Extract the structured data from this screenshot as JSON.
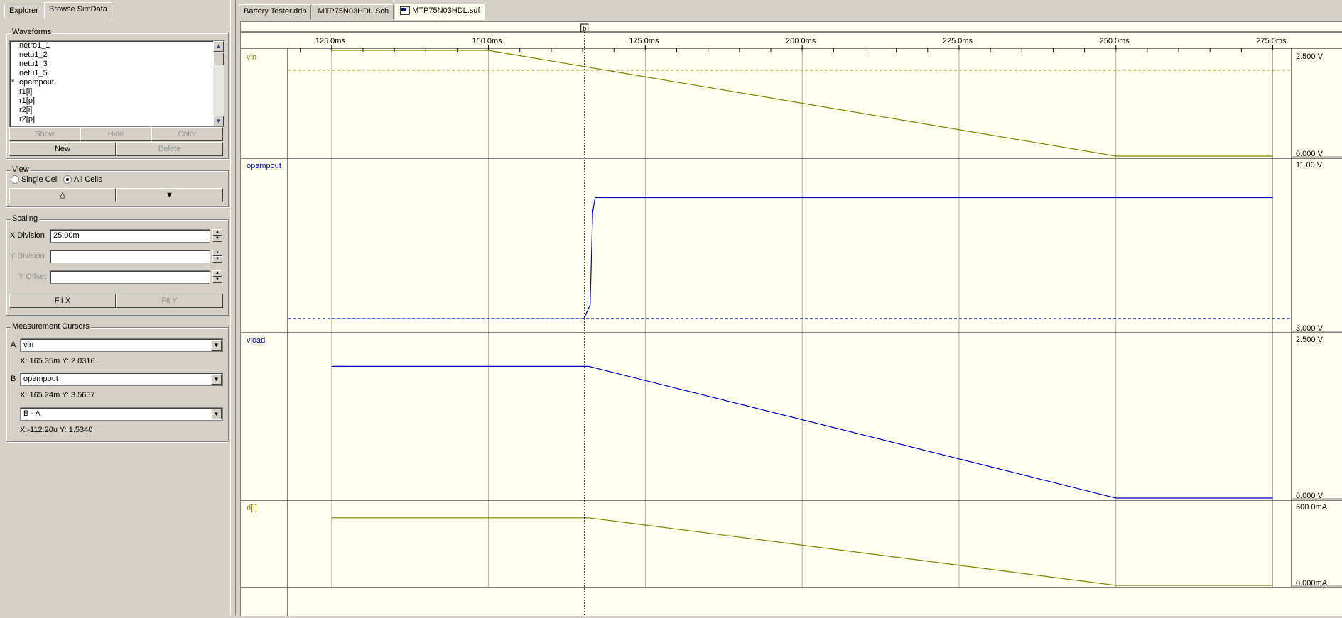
{
  "left_panel": {
    "tabs": [
      {
        "label": "Explorer"
      },
      {
        "label": "Browse SimData"
      }
    ],
    "waveforms": {
      "legend": "Waveforms",
      "items": [
        {
          "label": "netro1_1",
          "star": ""
        },
        {
          "label": "netu1_2",
          "star": ""
        },
        {
          "label": "netu1_3",
          "star": ""
        },
        {
          "label": "netu1_5",
          "star": ""
        },
        {
          "label": "opampout",
          "star": "*"
        },
        {
          "label": "r1[i]",
          "star": ""
        },
        {
          "label": "r1[p]",
          "star": ""
        },
        {
          "label": "r2[i]",
          "star": ""
        },
        {
          "label": "r2[p]",
          "star": ""
        }
      ],
      "show_label": "Show",
      "hide_label": "Hide",
      "color_label": "Color",
      "new_label": "New",
      "delete_label": "Delete"
    },
    "view": {
      "legend": "View",
      "single_cell_label": "Single Cell",
      "all_cells_label": "All Cells",
      "selected": "All Cells",
      "up_label": "△",
      "down_label": "▼"
    },
    "scaling": {
      "legend": "Scaling",
      "x_division_label": "X Division",
      "x_division_value": "25.00m",
      "y_division_label": "Y Division",
      "y_division_value": "",
      "y_offset_label": "Y Offset",
      "y_offset_value": "",
      "fit_x_label": "Fit X",
      "fit_y_label": "Fit Y"
    },
    "cursors": {
      "legend": "Measurement Cursors",
      "a_label": "A",
      "a_value": "vin",
      "a_readout": "X: 165.35m  Y: 2.0316",
      "b_label": "B",
      "b_value": "opampout",
      "b_readout": "X: 165.24m  Y: 3.5657",
      "diff_value": "B - A",
      "diff_readout": "X:-112.20u  Y: 1.5340"
    }
  },
  "doc_tabs": [
    {
      "label": "Battery Tester.ddb",
      "active": false
    },
    {
      "label": "MTP75N03HDL.Sch",
      "active": false
    },
    {
      "label": "MTP75N03HDL.sdf",
      "active": true
    }
  ],
  "chart_data": {
    "type": "line",
    "x_unit": "ms",
    "xlim": [
      118,
      278
    ],
    "x_ticks": [
      125,
      150,
      175,
      200,
      225,
      250,
      275
    ],
    "x_tick_labels": [
      "125.0ms",
      "150.0ms",
      "175.0ms",
      "200.0ms",
      "225.0ms",
      "250.0ms",
      "275.0ms"
    ],
    "cursor_marker": "b",
    "cursor_x": 165.3,
    "colors": {
      "olive": "#808000",
      "blue": "#0000c0",
      "grid": "#b0b0a0",
      "bg": "#fffff0"
    },
    "cells": [
      {
        "name": "vin",
        "color": "#808000",
        "ymin": 0,
        "ymax": 2.5,
        "ymin_label": "0.000 V",
        "ymax_label": "2.500 V",
        "ref_y": 2.0316,
        "x": [
          125,
          150,
          250,
          275
        ],
        "y": [
          2.5,
          2.5,
          0.0,
          0.0
        ]
      },
      {
        "name": "opampout",
        "color": "#0000c0",
        "ymin": 3,
        "ymax": 11,
        "ymin_label": "3.000 V",
        "ymax_label": "11.00 V",
        "ref_y": 3.5657,
        "x": [
          125,
          165.2,
          166.2,
          166.6,
          167.0,
          275
        ],
        "y": [
          3.55,
          3.55,
          4.2,
          8.5,
          9.2,
          9.2
        ]
      },
      {
        "name": "vload",
        "color": "#0000c0",
        "ymin": 0,
        "ymax": 2.5,
        "ymin_label": "0.000 V",
        "ymax_label": "2.500 V",
        "x": [
          125,
          166,
          250,
          275
        ],
        "y": [
          2.0,
          2.0,
          0.0,
          0.0
        ]
      },
      {
        "name": "rl[i]",
        "color": "#808000",
        "ymin": 0,
        "ymax": 600,
        "ymin_label": "0.000mA",
        "ymax_label": "600.0mA",
        "x": [
          125,
          166,
          250,
          275
        ],
        "y": [
          480,
          480,
          0,
          0
        ]
      }
    ]
  }
}
